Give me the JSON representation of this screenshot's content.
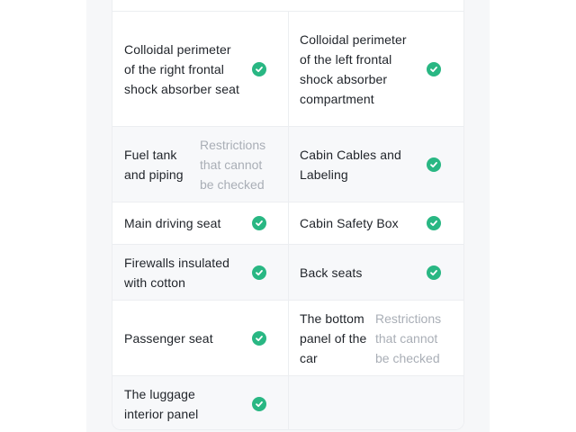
{
  "colors": {
    "check": "#29b783",
    "text": "#1f2329",
    "muted": "#a9aeb6",
    "row_shade": "#f7f8fa"
  },
  "check_icon": "check-circle-icon",
  "rows": [
    {
      "left": {
        "label": "Colloidal perimeter of the right frontal shock absorber seat",
        "status": "check"
      },
      "right": {
        "label": "Colloidal perimeter of the left frontal shock absorber compartment",
        "status": "check"
      }
    },
    {
      "left": {
        "label": "Fuel tank and piping",
        "status_text": "Restrictions that cannot be checked"
      },
      "right": {
        "label": "Cabin Cables and Labeling",
        "status": "check"
      }
    },
    {
      "left": {
        "label": "Main driving seat",
        "status": "check"
      },
      "right": {
        "label": "Cabin Safety Box",
        "status": "check"
      }
    },
    {
      "left": {
        "label": "Firewalls insulated with cotton",
        "status": "check"
      },
      "right": {
        "label": "Back seats",
        "status": "check"
      }
    },
    {
      "left": {
        "label": "Passenger seat",
        "status": "check"
      },
      "right": {
        "label": "The bottom panel of the car",
        "status_text": "Restrictions that cannot be checked"
      }
    },
    {
      "left": {
        "label": "The luggage interior panel",
        "status": "check"
      },
      "right": null
    }
  ]
}
